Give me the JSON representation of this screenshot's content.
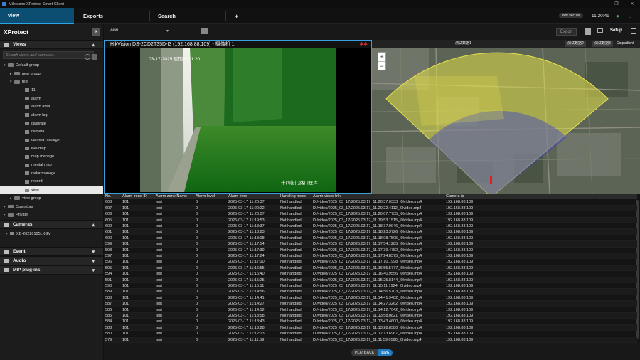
{
  "window": {
    "title": "Milestone XProtect Smart Client"
  },
  "nav": {
    "tabs": [
      {
        "label": "view"
      },
      {
        "label": "Exports"
      },
      {
        "label": "Search"
      }
    ],
    "add": "+",
    "status": "Not secure",
    "time": "11:20:49",
    "setup": "Setup"
  },
  "sidebar": {
    "title": "XProtect",
    "views_label": "Views",
    "search_placeholder": "Search views and cameras...",
    "tree": [
      {
        "label": "Default group",
        "level": 0,
        "type": "folder",
        "exp": "▾"
      },
      {
        "label": "new group",
        "level": 1,
        "type": "folder",
        "exp": "▸"
      },
      {
        "label": "test",
        "level": 1,
        "type": "folder",
        "exp": "▾"
      },
      {
        "label": "11",
        "level": 2,
        "type": "view"
      },
      {
        "label": "alarm",
        "level": 2,
        "type": "view"
      },
      {
        "label": "alarm area",
        "level": 2,
        "type": "view"
      },
      {
        "label": "alarm log",
        "level": 2,
        "type": "view"
      },
      {
        "label": "calibrate",
        "level": 2,
        "type": "view"
      },
      {
        "label": "camera",
        "level": 2,
        "type": "view"
      },
      {
        "label": "camera manage",
        "level": 2,
        "type": "view"
      },
      {
        "label": "live-map",
        "level": 2,
        "type": "view"
      },
      {
        "label": "map manage",
        "level": 2,
        "type": "view"
      },
      {
        "label": "mental map",
        "level": 2,
        "type": "view"
      },
      {
        "label": "radar manage",
        "level": 2,
        "type": "view"
      },
      {
        "label": "record",
        "level": 2,
        "type": "view"
      },
      {
        "label": "view",
        "level": 2,
        "type": "view",
        "selected": true
      },
      {
        "label": "view group",
        "level": 1,
        "type": "folder",
        "exp": "▸"
      },
      {
        "label": "Operators",
        "level": 0,
        "type": "folder",
        "exp": "▸"
      },
      {
        "label": "Private",
        "level": 0,
        "type": "folder",
        "exp": "▸"
      }
    ],
    "cameras_label": "Cameras",
    "camera_item": "XB-20220105LKGV",
    "sections": [
      {
        "label": "Event"
      },
      {
        "label": "Audio"
      },
      {
        "label": "MIP plug-ins"
      }
    ]
  },
  "toolbar": {
    "view_select": "view",
    "export": "Export"
  },
  "camera": {
    "title": "HikVision DS-2CD2T35D-I3 (192.168.88.109) - 摄像机 1",
    "osd_date": "03-17-2025 星期一 11:20",
    "osd_label": "十四街门路口仓库"
  },
  "map": {
    "tabs": [
      "测试数据1",
      "测试数据2",
      "测试数据3",
      "Cogradient"
    ],
    "zoom_in": "+",
    "zoom_out": "−"
  },
  "table": {
    "columns": [
      "No.",
      "Alarm zone ID",
      "Alarm zone Name",
      "Alarm level",
      "Alarm time",
      "Handling mode",
      "Alarm video link",
      "Camera ip"
    ],
    "rows": [
      [
        "608",
        "101",
        "test",
        "0",
        "2025-03-17 11:20:37",
        "Not handled",
        "D:/video/2025_03_17/2025.03.17_11.20.37.0333_l0lvideo.mp4",
        "192.168.88.109"
      ],
      [
        "607",
        "101",
        "test",
        "0",
        "2025-03-17 11:20:22",
        "Not handled",
        "D:/video/2025_03_17/2025.03.17_11.20.22.4112_l0lvideo.mp4",
        "192.168.88.109"
      ],
      [
        "606",
        "101",
        "test",
        "0",
        "2025-03-17 11:20:07",
        "Not handled",
        "D:/video/2025_03_17/2025.03.17_11.20.07.7735_l0lvideo.mp4",
        "192.168.88.109"
      ],
      [
        "605",
        "101",
        "test",
        "0",
        "2025-03-17 11:19:53",
        "Not handled",
        "D:/video/2025_03_17/2025.03.17_11.19.53.1515_l0lvideo.mp4",
        "192.168.88.109"
      ],
      [
        "602",
        "101",
        "test",
        "0",
        "2025-03-17 11:18:37",
        "Not handled",
        "D:/video/2025_03_17/2025.03.17_11.18.37.9946_l0lvideo.mp4",
        "192.168.88.109"
      ],
      [
        "601",
        "101",
        "test",
        "0",
        "2025-03-17 11:18:23",
        "Not handled",
        "D:/video/2025_03_17/2025.03.17_11.18.23.3726_l0lvideo.mp4",
        "192.168.88.109"
      ],
      [
        "600",
        "101",
        "test",
        "0",
        "2025-03-17 11:18:08",
        "Not handled",
        "D:/video/2025_03_17/2025.03.17_11.18.08.7505_l0lvideo.mp4",
        "192.168.88.109"
      ],
      [
        "599",
        "101",
        "test",
        "0",
        "2025-03-17 11:17:54",
        "Not handled",
        "D:/video/2025_03_17/2025.03.17_11.17.54.1285_l0lvideo.mp4",
        "192.168.88.109"
      ],
      [
        "598",
        "101",
        "test",
        "0",
        "2025-03-17 11:17:39",
        "Not handled",
        "D:/video/2025_03_17/2025.03.17_11.17.39.4752_l0lvideo.mp4",
        "192.168.88.109"
      ],
      [
        "597",
        "101",
        "test",
        "0",
        "2025-03-17 11:17:24",
        "Not handled",
        "D:/video/2025_03_17/2025.03.17_11.17.24.8375_l0lvideo.mp4",
        "192.168.88.109"
      ],
      [
        "596",
        "101",
        "test",
        "0",
        "2025-03-17 11:17:10",
        "Not handled",
        "D:/video/2025_03_17/2025.03.17_11.17.10.1998_l0lvideo.mp4",
        "192.168.88.109"
      ],
      [
        "595",
        "101",
        "test",
        "0",
        "2025-03-17 11:16:55",
        "Not handled",
        "D:/video/2025_03_17/2025.03.17_11.16.55.5777_l0lvideo.mp4",
        "192.168.88.109"
      ],
      [
        "594",
        "101",
        "test",
        "0",
        "2025-03-17 11:16:40",
        "Not handled",
        "D:/video/2025_03_17/2025.03.17_11.16.40.9556_l0lvideo.mp4",
        "192.168.88.109"
      ],
      [
        "591",
        "101",
        "test",
        "0",
        "2025-03-17 11:15:25",
        "Not handled",
        "D:/video/2025_03_17/2025.03.17_11.15.25.8144_l0lvideo.mp4",
        "192.168.88.109"
      ],
      [
        "590",
        "101",
        "test",
        "0",
        "2025-03-17 11:15:11",
        "Not handled",
        "D:/video/2025_03_17/2025.03.17_11.15.11.1924_l0lvideo.mp4",
        "192.168.88.109"
      ],
      [
        "589",
        "101",
        "test",
        "0",
        "2025-03-17 11:14:56",
        "Not handled",
        "D:/video/2025_03_17/2025.03.17_11.14.56.5703_l0lvideo.mp4",
        "192.168.88.109"
      ],
      [
        "588",
        "101",
        "test",
        "0",
        "2025-03-17 11:14:41",
        "Not handled",
        "D:/video/2025_03_17/2025.03.17_11.14.41.9482_l0lvideo.mp4",
        "192.168.88.109"
      ],
      [
        "587",
        "101",
        "test",
        "0",
        "2025-03-17 11:14:27",
        "Not handled",
        "D:/video/2025_03_17/2025.03.17_11.14.27.3262_l0lvideo.mp4",
        "192.168.88.109"
      ],
      [
        "586",
        "101",
        "test",
        "0",
        "2025-03-17 11:14:12",
        "Not handled",
        "D:/video/2025_03_17/2025.03.17_11.14.12.7042_l0lvideo.mp4",
        "192.168.88.109"
      ],
      [
        "585",
        "101",
        "test",
        "0",
        "2025-03-17 11:13:58",
        "Not handled",
        "D:/video/2025_03_17/2025.03.17_11.13.58.0821_l0lvideo.mp4",
        "192.168.88.109"
      ],
      [
        "584",
        "101",
        "test",
        "0",
        "2025-03-17 11:13:43",
        "Not handled",
        "D:/video/2025_03_17/2025.03.17_11.13.43.4600_l0lvideo.mp4",
        "192.168.88.109"
      ],
      [
        "583",
        "101",
        "test",
        "0",
        "2025-03-17 11:13:28",
        "Not handled",
        "D:/video/2025_03_17/2025.03.17_11.13.28.8380_l0lvideo.mp4",
        "192.168.88.109"
      ],
      [
        "580",
        "101",
        "test",
        "0",
        "2025-03-17 11:12:13",
        "Not handled",
        "D:/video/2025_03_17/2025.03.17_11.12.13.6967_l0lvideo.mp4",
        "192.168.88.109"
      ],
      [
        "579",
        "101",
        "test",
        "0",
        "2025-03-17 11:11:59",
        "Not handled",
        "D:/video/2025_03_17/2025.03.17_11.11.59.0590_l0lvideo.mp4",
        "192.168.88.109"
      ]
    ]
  },
  "footer": {
    "playback": "PLAYBACK",
    "live": "LIVE"
  },
  "colors": {
    "accent": "#2aa6e8",
    "active_tab": "#0c4d72",
    "overlay_yellow": "#e6e24a",
    "overlay_blue": "#3b42c8"
  }
}
